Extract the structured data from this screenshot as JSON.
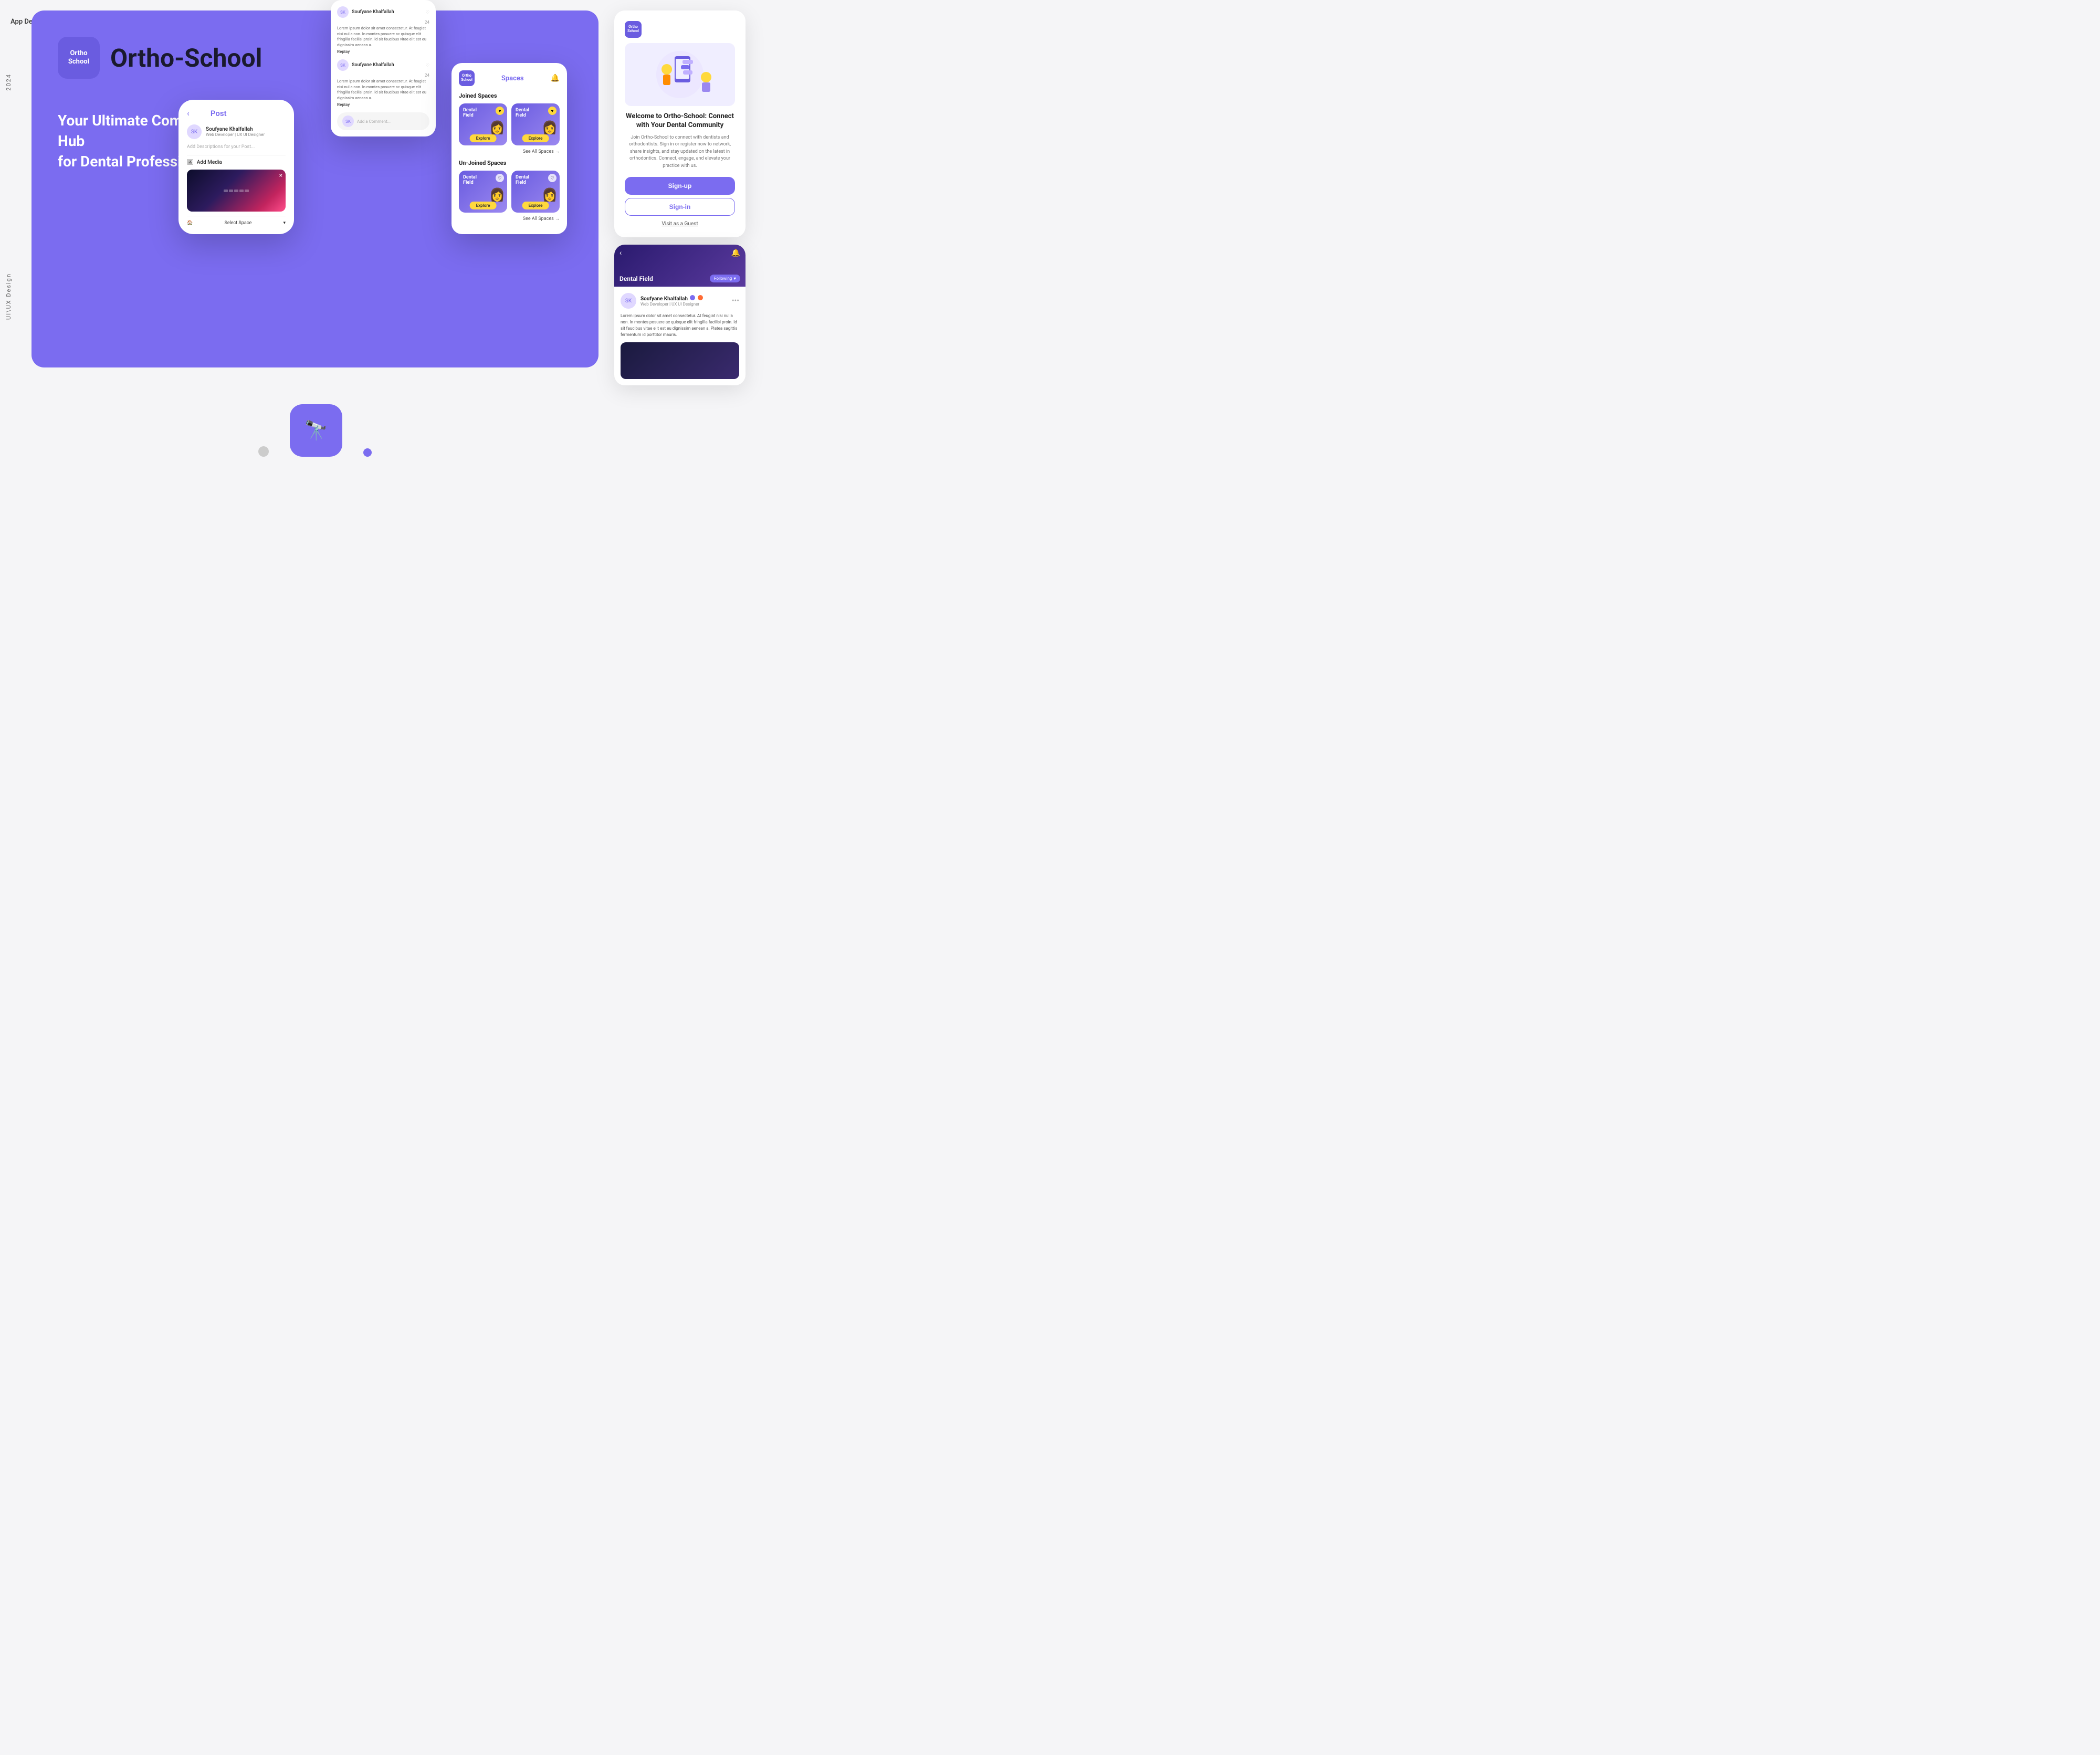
{
  "meta": {
    "app_design_label": "App Design",
    "year_label": "2024",
    "ui_ux_label": "UI\\UX Design"
  },
  "hero": {
    "logo_line1": "Ortho",
    "logo_line2": "School",
    "app_name": "Ortho-School",
    "tagline_line1": "Your Ultimate Community Hub",
    "tagline_line2": "for Dental Professionals!"
  },
  "post_screen": {
    "back_label": "‹",
    "title": "Post",
    "user_name": "Soufyane Khalfallah",
    "user_verified": true,
    "user_title": "Web Developer | UX UI Designer",
    "description_placeholder": "Add Descriptions for your Post...",
    "add_media_label": "Add Media",
    "select_space_label": "Select Space",
    "close_x": "×"
  },
  "comments_screen": {
    "reply_label": "Replay",
    "comments": [
      {
        "user": "Soufyane Khalfallah",
        "text": "Lorem ipsum dolor sit amet consectetur. At feugiat nisi nulla non. In montes posuere ac quisque elit fringilla facilisi proin. Id sit faucibus vitae elit est eu dignissim aenean a.",
        "hearts": 24
      },
      {
        "user": "Soufyane Khalfallah",
        "text": "Lorem ipsum dolor sit amet consectetur. At feugiat nisi nulla non. In montes posuere ac quisque elit fringilla facilisi proin. Id sit faucibus vitae elit est eu dignissim aenean a.",
        "hearts": 24
      }
    ],
    "add_comment_placeholder": "Add a Comment..."
  },
  "spaces_screen": {
    "title": "Spaces",
    "joined_spaces_label": "Joined Spaces",
    "unjoined_spaces_label": "Un-Joined Spaces",
    "see_all_label": "See All Spaces →",
    "explore_label": "Explore",
    "space_cards": [
      {
        "label": "Dental\nField",
        "joined": true
      },
      {
        "label": "Dental\nField",
        "joined": true
      },
      {
        "label": "Dental\nField",
        "joined": false
      },
      {
        "label": "Dental\nField",
        "joined": false
      }
    ]
  },
  "welcome_panel": {
    "title": "Welcome to Ortho-School: Connect with Your Dental Community",
    "description": "Join Ortho-School to connect with dentists and orthodontists. Sign in or register now to network, share insights, and stay updated on the latest in orthodontics. Connect, engage, and elevate your practice with us.",
    "signup_label": "Sign-up",
    "signin_label": "Sign-in",
    "guest_label": "Visit as a Guest"
  },
  "post_preview_panel": {
    "field_label": "Dental Field",
    "following_label": "Following",
    "user_name": "Soufyane Khalfallah",
    "user_title": "Web Developer | UX UI Designer",
    "body_text": "Lorem ipsum dolor sit amet consectetur. At feugiat nisi nulla non. In montes posuere ac quisque elit fringilla facilisi proin. Id sit faucibus vitae elit est eu dignissim aenean a. Platea sagittis fermentum id porttitor mauris."
  },
  "bottom": {
    "dots": [
      true,
      false
    ]
  },
  "right_panel_header": {
    "logo_line1": "Ortho",
    "logo_line2": "School"
  }
}
